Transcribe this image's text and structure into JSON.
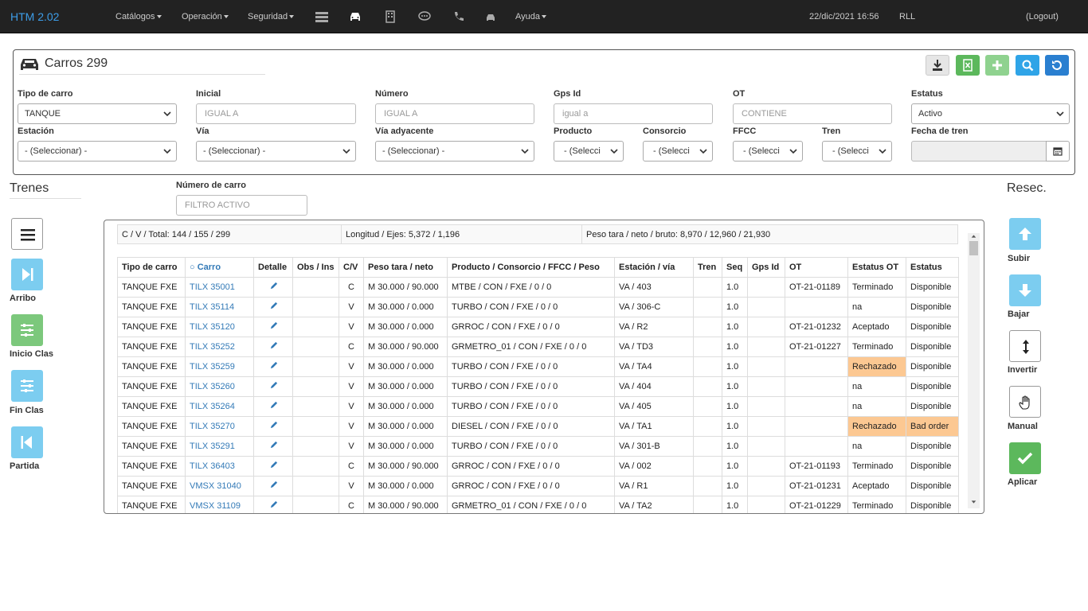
{
  "nav": {
    "brand": "HTM 2.02",
    "menus": [
      "Catálogos",
      "Operación",
      "Seguridad"
    ],
    "help": "Ayuda",
    "datetime": "22/dic/2021 16:56",
    "user": "RLL",
    "logout": "(Logout)"
  },
  "panel": {
    "title": "Carros 299",
    "filters": {
      "tipo_carro": {
        "label": "Tipo de carro",
        "value": "TANQUE"
      },
      "inicial": {
        "label": "Inicial",
        "placeholder": "IGUAL A"
      },
      "numero": {
        "label": "Número",
        "placeholder": "IGUAL A"
      },
      "gps": {
        "label": "Gps Id",
        "placeholder": "igual a"
      },
      "ot": {
        "label": "OT",
        "placeholder": "CONTIENE"
      },
      "estatus": {
        "label": "Estatus",
        "value": "Activo"
      },
      "estacion": {
        "label": "Estación",
        "value": "- (Seleccionar) -"
      },
      "via": {
        "label": "Vía",
        "value": "- (Seleccionar) -"
      },
      "via_ady": {
        "label": "Vía adyacente",
        "value": "- (Seleccionar) -"
      },
      "producto": {
        "label": "Producto",
        "value": "- (Selecci"
      },
      "consorcio": {
        "label": "Consorcio",
        "value": "- (Selecci"
      },
      "ffcc": {
        "label": "FFCC",
        "value": "- (Selecci"
      },
      "tren": {
        "label": "Tren",
        "value": "- (Selecci"
      },
      "fecha_tren": {
        "label": "Fecha de tren"
      }
    }
  },
  "left": {
    "title": "Trenes",
    "buttons": [
      "Arribo",
      "Inicio Clas",
      "Fin Clas",
      "Partida"
    ]
  },
  "search": {
    "label": "Número de carro",
    "placeholder": "FILTRO ACTIVO"
  },
  "right": {
    "title": "Resec.",
    "buttons": [
      "Subir",
      "Bajar",
      "Invertir",
      "Manual",
      "Aplicar"
    ]
  },
  "summary": {
    "totals": "C / V / Total: 144 / 155 / 299",
    "length": "Longitud / Ejes: 5,372 / 1,196",
    "weight": "Peso tara / neto / bruto: 8,970 / 12,960 / 21,930"
  },
  "table": {
    "headers": [
      "Tipo de carro",
      "Carro",
      "Detalle",
      "Obs / Ins",
      "C/V",
      "Peso tara / neto",
      "Producto / Consorcio / FFCC / Peso",
      "Estación / vía",
      "Tren",
      "Seq",
      "Gps Id",
      "OT",
      "Estatus OT",
      "Estatus"
    ],
    "rows": [
      [
        "TANQUE FXE",
        "TILX 35001",
        "",
        "C",
        "M 30.000 / 90.000",
        "MTBE / CON / FXE / 0 / 0",
        "VA / 403",
        "",
        "1.0",
        "",
        "OT-21-01189",
        "Terminado",
        "Disponible"
      ],
      [
        "TANQUE FXE",
        "TILX 35114",
        "",
        "V",
        "M 30.000 / 0.000",
        "TURBO / CON / FXE / 0 / 0",
        "VA / 306-C",
        "",
        "1.0",
        "",
        "",
        "na",
        "Disponible"
      ],
      [
        "TANQUE FXE",
        "TILX 35120",
        "",
        "V",
        "M 30.000 / 0.000",
        "GRROC / CON / FXE / 0 / 0",
        "VA / R2",
        "",
        "1.0",
        "",
        "OT-21-01232",
        "Aceptado",
        "Disponible"
      ],
      [
        "TANQUE FXE",
        "TILX 35252",
        "",
        "C",
        "M 30.000 / 90.000",
        "GRMETRO_01 / CON / FXE / 0 / 0",
        "VA / TD3",
        "",
        "1.0",
        "",
        "OT-21-01227",
        "Terminado",
        "Disponible"
      ],
      [
        "TANQUE FXE",
        "TILX 35259",
        "",
        "V",
        "M 30.000 / 0.000",
        "TURBO / CON / FXE / 0 / 0",
        "VA / TA4",
        "",
        "1.0",
        "",
        "",
        "Rechazado",
        "Disponible"
      ],
      [
        "TANQUE FXE",
        "TILX 35260",
        "",
        "V",
        "M 30.000 / 0.000",
        "TURBO / CON / FXE / 0 / 0",
        "VA / 404",
        "",
        "1.0",
        "",
        "",
        "na",
        "Disponible"
      ],
      [
        "TANQUE FXE",
        "TILX 35264",
        "",
        "V",
        "M 30.000 / 0.000",
        "TURBO / CON / FXE / 0 / 0",
        "VA / 405",
        "",
        "1.0",
        "",
        "",
        "na",
        "Disponible"
      ],
      [
        "TANQUE FXE",
        "TILX 35270",
        "",
        "V",
        "M 30.000 / 0.000",
        "DIESEL / CON / FXE / 0 / 0",
        "VA / TA1",
        "",
        "1.0",
        "",
        "",
        "Rechazado",
        "Bad order"
      ],
      [
        "TANQUE FXE",
        "TILX 35291",
        "",
        "V",
        "M 30.000 / 0.000",
        "TURBO / CON / FXE / 0 / 0",
        "VA / 301-B",
        "",
        "1.0",
        "",
        "",
        "na",
        "Disponible"
      ],
      [
        "TANQUE FXE",
        "TILX 36403",
        "",
        "C",
        "M 30.000 / 90.000",
        "GRROC / CON / FXE / 0 / 0",
        "VA / 002",
        "",
        "1.0",
        "",
        "OT-21-01193",
        "Terminado",
        "Disponible"
      ],
      [
        "TANQUE FXE",
        "VMSX 31040",
        "",
        "V",
        "M 30.000 / 0.000",
        "GRROC / CON / FXE / 0 / 0",
        "VA / R1",
        "",
        "1.0",
        "",
        "OT-21-01231",
        "Aceptado",
        "Disponible"
      ],
      [
        "TANQUE FXE",
        "VMSX 31109",
        "",
        "C",
        "M 30.000 / 90.000",
        "GRMETRO_01 / CON / FXE / 0 / 0",
        "VA / TA2",
        "",
        "1.0",
        "",
        "OT-21-01229",
        "Terminado",
        "Disponible"
      ]
    ],
    "highlight_color": "#fcc892"
  }
}
